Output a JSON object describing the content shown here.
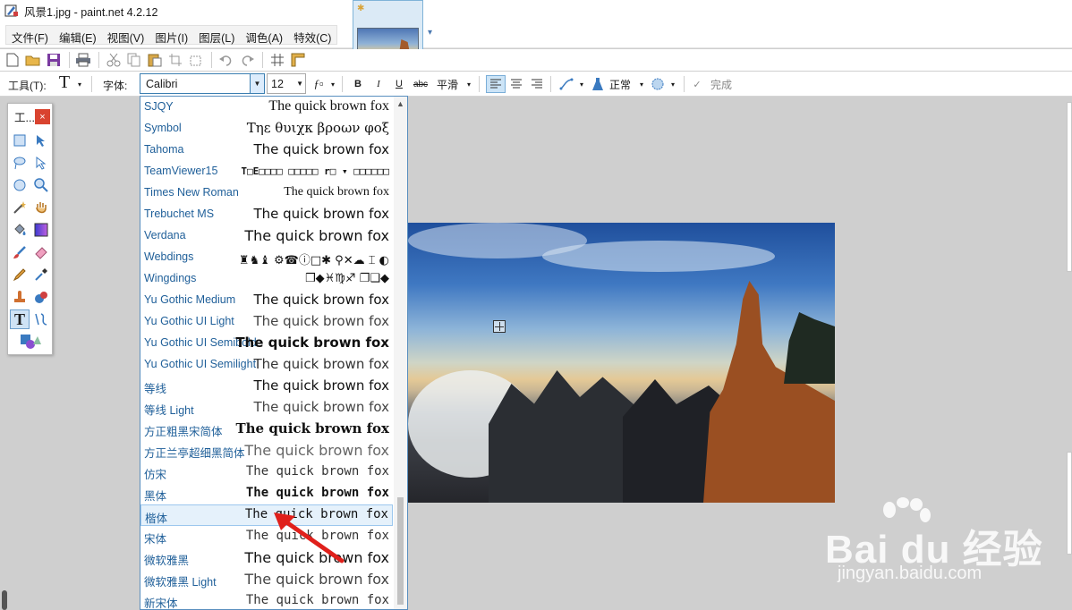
{
  "window": {
    "title": "风景1.jpg - paint.net 4.2.12"
  },
  "menu": {
    "items": [
      "文件(F)",
      "编辑(E)",
      "视图(V)",
      "图片(I)",
      "图层(L)",
      "调色(A)",
      "特效(C)"
    ]
  },
  "toolbar2": {
    "tool_label": "工具(T):",
    "font_label": "字体:",
    "font_value": "Calibri",
    "size_value": "12",
    "bold": "B",
    "italic": "I",
    "underline": "U",
    "strike": "abc",
    "antialias": "平滑",
    "blend_mode": "正常",
    "finish": "完成"
  },
  "tools_panel": {
    "title": "工...",
    "close": "×"
  },
  "font_list": [
    {
      "name": "SJQY",
      "sample": "The quick brown fox"
    },
    {
      "name": "Symbol",
      "sample": "Τηε θυιχκ βροων φοξ"
    },
    {
      "name": "Tahoma",
      "sample": "The quick brown fox"
    },
    {
      "name": "TeamViewer15",
      "sample": "T□E□□□□ □□□□□ r□ ▾ □□□□□□"
    },
    {
      "name": "Times New Roman",
      "sample": "The quick brown fox"
    },
    {
      "name": "Trebuchet MS",
      "sample": "The quick brown fox"
    },
    {
      "name": "Verdana",
      "sample": "The quick brown fox"
    },
    {
      "name": "Webdings",
      "sample": "♜♞♝ ⚙☎ⓘ□✱ ⚲✕☁ ⌶ ◐"
    },
    {
      "name": "Wingdings",
      "sample": "❒◆♓♍♐ ❐❑◆"
    },
    {
      "name": "Yu Gothic Medium",
      "sample": "The quick brown fox"
    },
    {
      "name": "Yu Gothic UI Light",
      "sample": "The quick brown fox"
    },
    {
      "name": "Yu Gothic UI Semibold",
      "sample": "The quick brown fox"
    },
    {
      "name": "Yu Gothic UI Semilight",
      "sample": "The quick brown fox"
    },
    {
      "name": "等线",
      "sample": "The quick brown fox"
    },
    {
      "name": "等线 Light",
      "sample": "The quick brown fox"
    },
    {
      "name": "方正粗黑宋简体",
      "sample": "The quick brown fox"
    },
    {
      "name": "方正兰亭超细黑简体",
      "sample": "The quick brown fox"
    },
    {
      "name": "仿宋",
      "sample": "The quick brown fox"
    },
    {
      "name": "黑体",
      "sample": "The quick brown fox"
    },
    {
      "name": "楷体",
      "sample": "The quick brown fox"
    },
    {
      "name": "宋体",
      "sample": "The quick brown fox"
    },
    {
      "name": "微软雅黑",
      "sample": "The quick brown fox"
    },
    {
      "name": "微软雅黑 Light",
      "sample": "The quick brown fox"
    },
    {
      "name": "新宋体",
      "sample": "The quick brown fox"
    }
  ],
  "watermark": {
    "brand": "Bai du 经验",
    "url": "jingyan.baidu.com"
  },
  "icons": {
    "tab_dirty": "✱",
    "dropdown": "▾"
  }
}
